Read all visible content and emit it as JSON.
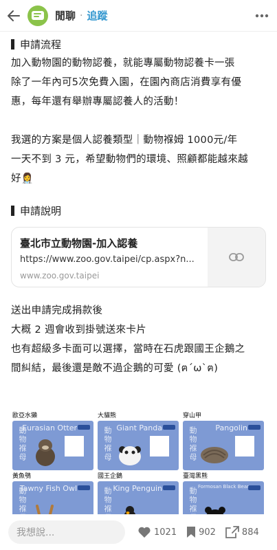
{
  "header": {
    "board_name": "閒聊",
    "separator": "·",
    "follow_label": "追蹤"
  },
  "post": {
    "section1_title": "申請流程",
    "section1_lines": [
      "加入動物園的動物認養，就能專屬動物認養卡一張",
      "除了一年內可5次免費入園，在園內商店消費享有優",
      "惠，每年還有舉辦專屬認養人的活動！"
    ],
    "section2_lines": [
      "我選的方案是個人認養類型｜動物褓姆 1000元/年",
      "一天不到 3 元，希望動物們的環境、照顧都能越來越",
      "好👩‍⚕️"
    ],
    "section3_title": "申請說明",
    "link_card": {
      "title": "臺北市立動物園-加入認養",
      "url": "https://www.zoo.gov.taipei/cp.aspx?n...",
      "domain": "www.zoo.gov.taipei"
    },
    "section4_lines": [
      "送出申請完成捐款後",
      "大概 2 週會收到掛號送來卡片",
      "也有超級多卡面可以選擇，當時在石虎跟國王企鵝之",
      "間糾結，最後還是敵不過企鵝的可愛 (ฅ´ω`ฅ)"
    ],
    "cards": [
      {
        "label": "歐亞水獺",
        "en": "Eurasian Otter",
        "vertical": "動物褓母"
      },
      {
        "label": "大貓熊",
        "en": "Giant Panda",
        "vertical": "動物褓母"
      },
      {
        "label": "穿山甲",
        "en": "Pangolin",
        "vertical": "動物褓母"
      },
      {
        "label": "黃魚鴞",
        "en": "Tawny Fish Owl",
        "vertical": "動物褓母"
      },
      {
        "label": "國王企鵝",
        "en": "King Penguin",
        "vertical": "動物褓母"
      },
      {
        "label": "臺灣黑熊",
        "en": "Formosan Black Bear",
        "vertical": "動物褓母"
      }
    ]
  },
  "bottom": {
    "comment_placeholder": "我想說...",
    "likes": "1021",
    "bookmarks": "902",
    "shares": "884"
  }
}
